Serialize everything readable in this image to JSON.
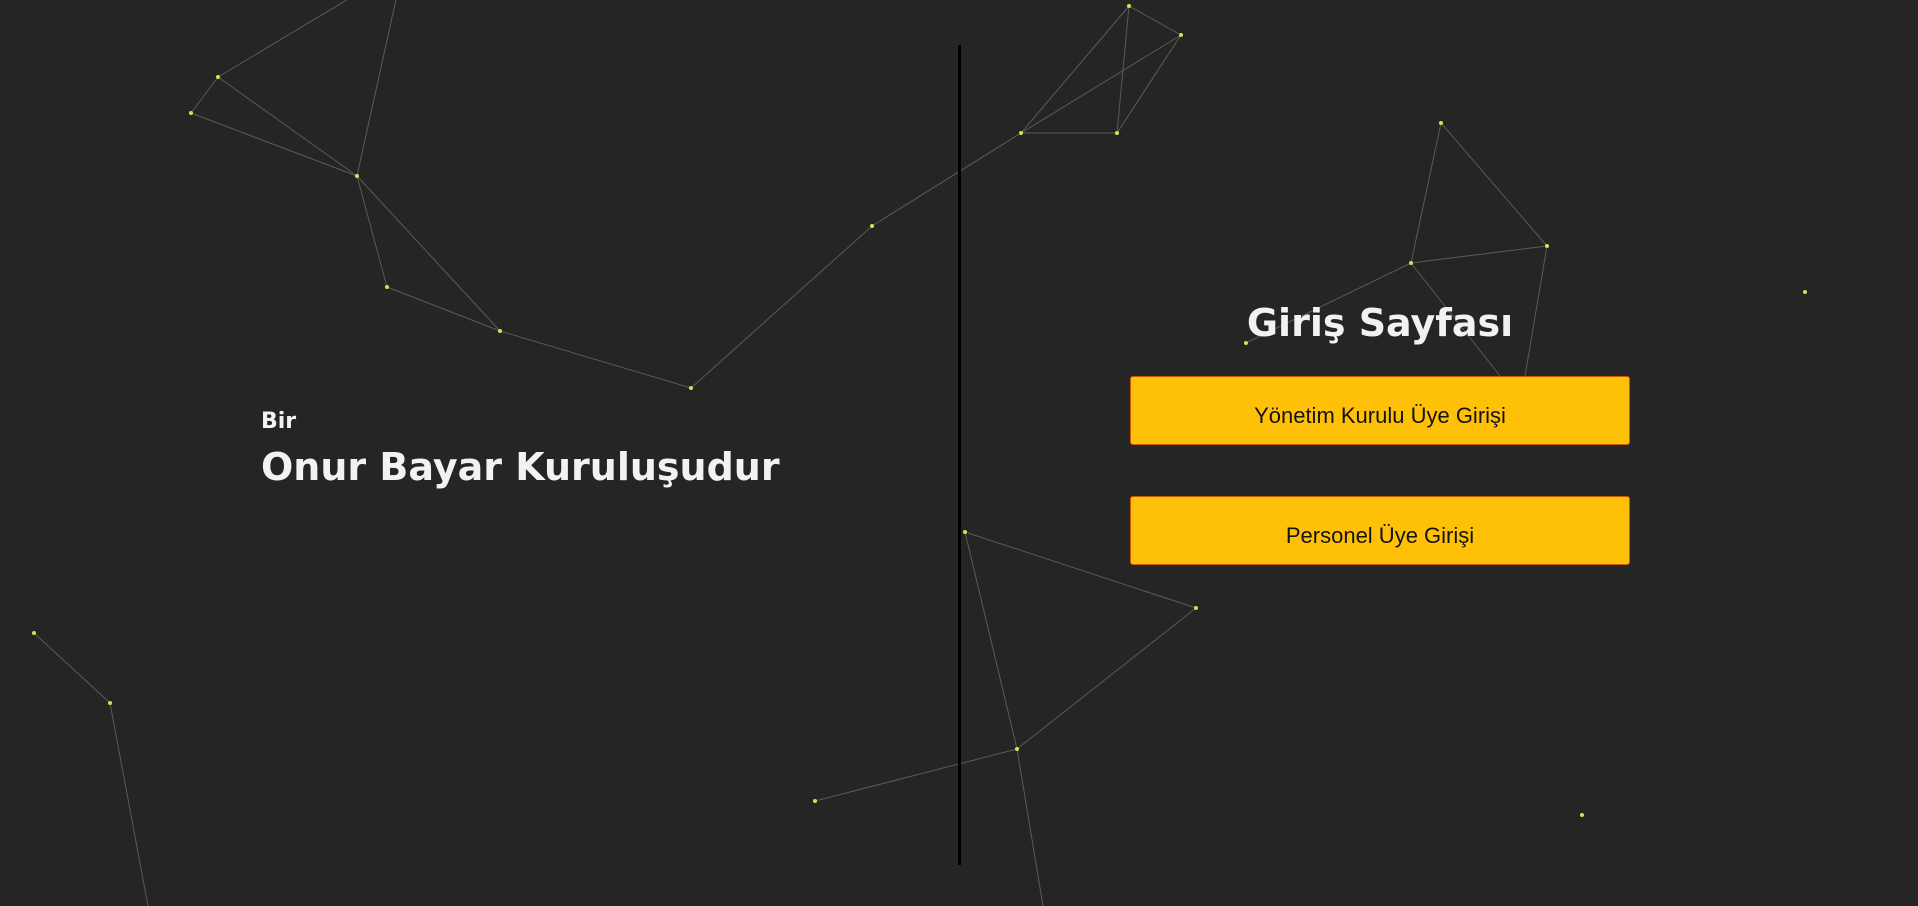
{
  "brand": {
    "prefix": "Bir",
    "name": "Onur Bayar Kuruluşudur"
  },
  "login": {
    "title": "Giriş Sayfası",
    "buttons": [
      {
        "label": "Yönetim Kurulu Üye Girişi"
      },
      {
        "label": "Personel Üye Girişi"
      }
    ]
  },
  "colors": {
    "background": "#252525",
    "accent": "#ffc107",
    "particle": "#d4e157",
    "line": "#5a5a5a"
  }
}
